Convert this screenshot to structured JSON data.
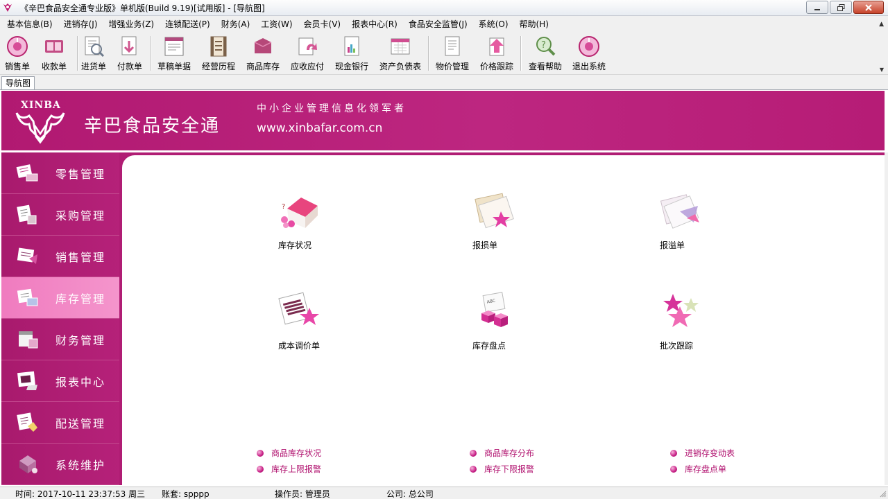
{
  "window": {
    "title": "《辛巴食品安全通专业版》单机版(Build 9.19)[试用版] - [导航图]"
  },
  "menu": [
    "基本信息(B)",
    "进销存(J)",
    "增强业务(Z)",
    "连锁配送(P)",
    "财务(A)",
    "工资(W)",
    "会员卡(V)",
    "报表中心(R)",
    "食品安全监管(J)",
    "系统(O)",
    "帮助(H)"
  ],
  "toolbar": [
    {
      "label": "销售单",
      "icon": "sales-order-icon"
    },
    {
      "label": "收款单",
      "icon": "receipt-icon"
    },
    {
      "label": "进货单",
      "icon": "purchase-order-icon"
    },
    {
      "label": "付款单",
      "icon": "payment-icon"
    },
    {
      "label": "草稿单据",
      "icon": "draft-document-icon"
    },
    {
      "label": "经营历程",
      "icon": "business-history-icon"
    },
    {
      "label": "商品库存",
      "icon": "goods-stock-icon"
    },
    {
      "label": "应收应付",
      "icon": "receivable-payable-icon"
    },
    {
      "label": "现金银行",
      "icon": "cash-bank-icon"
    },
    {
      "label": "资产负债表",
      "icon": "balance-sheet-icon"
    },
    {
      "label": "物价管理",
      "icon": "price-management-icon"
    },
    {
      "label": "价格跟踪",
      "icon": "price-tracking-icon"
    },
    {
      "label": "查看帮助",
      "icon": "help-icon"
    },
    {
      "label": "退出系统",
      "icon": "exit-icon"
    }
  ],
  "tab": {
    "label": "导航图"
  },
  "banner": {
    "logo_text": "XINBA",
    "brand_name": "辛巴食品安全通",
    "slogan": "中小企业管理信息化领军者",
    "url": "www.xinbafar.com.cn"
  },
  "sidebar": [
    {
      "label": "零售管理",
      "active": false
    },
    {
      "label": "采购管理",
      "active": false
    },
    {
      "label": "销售管理",
      "active": false
    },
    {
      "label": "库存管理",
      "active": true
    },
    {
      "label": "财务管理",
      "active": false
    },
    {
      "label": "报表中心",
      "active": false
    },
    {
      "label": "配送管理",
      "active": false
    },
    {
      "label": "系统维护",
      "active": false
    }
  ],
  "features": [
    {
      "label": "库存状况",
      "icon": "inventory-status-icon"
    },
    {
      "label": "报损单",
      "icon": "loss-report-icon"
    },
    {
      "label": "报溢单",
      "icon": "overflow-report-icon"
    },
    {
      "label": "成本调价单",
      "icon": "cost-adjustment-icon"
    },
    {
      "label": "库存盘点",
      "icon": "stocktaking-icon"
    },
    {
      "label": "批次跟踪",
      "icon": "batch-tracking-icon"
    }
  ],
  "links": [
    {
      "label": "商品库存状况"
    },
    {
      "label": "库存上限报警"
    },
    {
      "label": "商品库存分布"
    },
    {
      "label": "库存下限报警"
    },
    {
      "label": "进销存变动表"
    },
    {
      "label": "库存盘点单"
    }
  ],
  "status": {
    "time": "时间: 2017-10-11 23:37:53 周三",
    "account": "账套: spppp",
    "operator": "操作员: 管理员",
    "company": "公司: 总公司"
  },
  "colors": {
    "brand": "#b01d74",
    "active_nav": "#f28ac6",
    "link": "#b0106e"
  }
}
